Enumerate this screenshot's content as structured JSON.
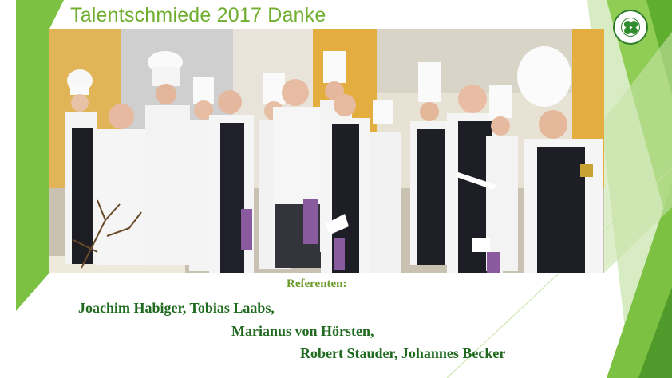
{
  "slide": {
    "title": "Talentschmiede 2017 Danke",
    "caption_heading": "Referenten:",
    "names": [
      "Joachim Habiger, Tobias Laabs,",
      "Marianus von Hörsten,",
      "Robert Stauder, Johannes Becker"
    ]
  },
  "photo": {
    "description_icon": "group-photo-image"
  },
  "logo": {
    "icon": "clover-seal-icon"
  },
  "colors": {
    "title": "#6fae2e",
    "names": "#1f6a1f",
    "caption_heading": "#6a9a2a",
    "accent_green": "#7cc142",
    "dark_green": "#2f7d2a"
  }
}
